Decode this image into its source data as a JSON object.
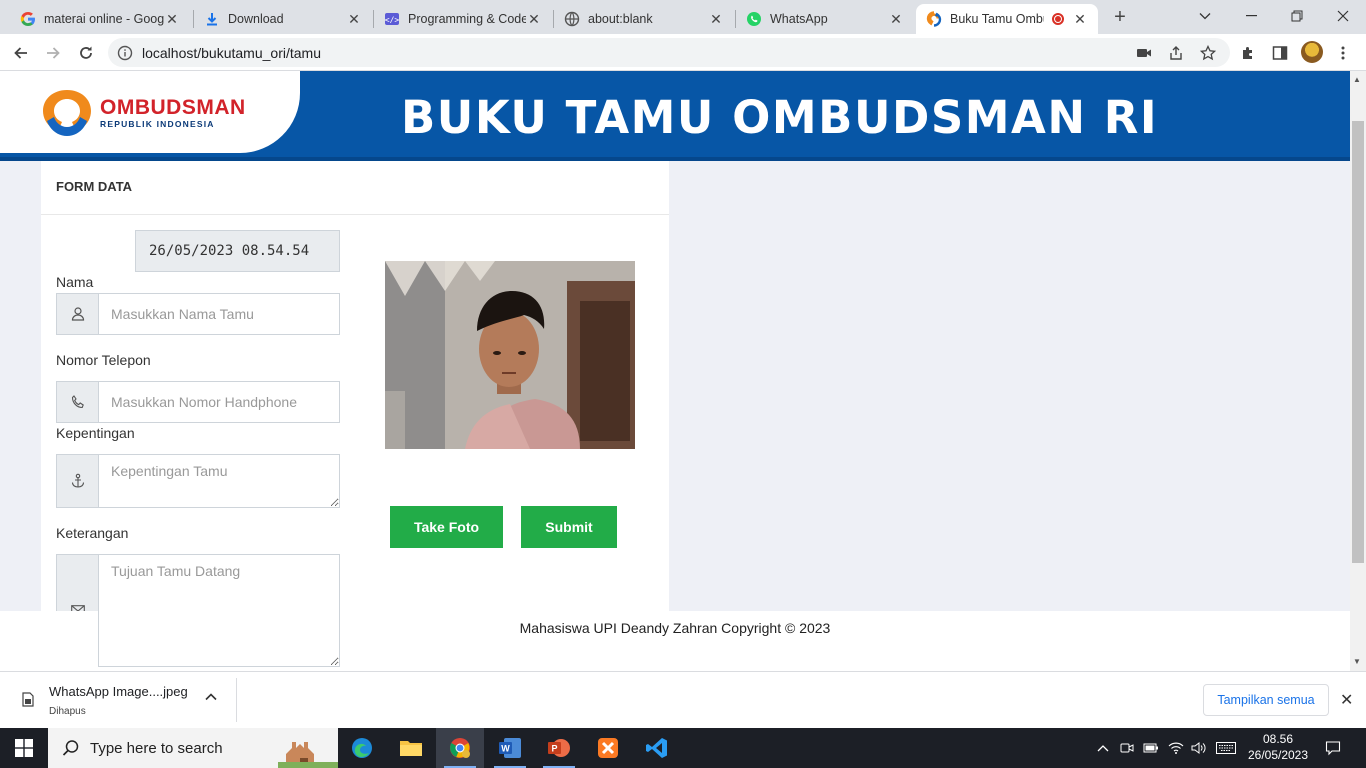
{
  "browser": {
    "tabs": [
      {
        "title": "materai online - Goog",
        "icon": "google-icon"
      },
      {
        "title": "Download",
        "icon": "download-icon"
      },
      {
        "title": "Programming & Code",
        "icon": "code-icon"
      },
      {
        "title": "about:blank",
        "icon": "globe-icon"
      },
      {
        "title": "WhatsApp",
        "icon": "whatsapp-icon"
      },
      {
        "title": "Buku Tamu Ombu",
        "icon": "ombudsman-icon",
        "active": true
      }
    ],
    "url": "localhost/bukutamu_ori/tamu"
  },
  "page": {
    "logo_name": "OMBUDSMAN",
    "logo_sub": "REPUBLIK INDONESIA",
    "banner_title": "BUKU TAMU OMBUDSMAN RI",
    "card_title": "FORM DATA",
    "datetime": "26/05/2023 08.54.54",
    "fields": {
      "nama_label": "Nama",
      "nama_placeholder": "Masukkan Nama Tamu",
      "telepon_label": "Nomor Telepon",
      "telepon_placeholder": "Masukkan Nomor Handphone",
      "kepentingan_label": "Kepentingan",
      "kepentingan_placeholder": "Kepentingan Tamu",
      "keterangan_label": "Keterangan",
      "keterangan_placeholder": "Tujuan Tamu Datang"
    },
    "buttons": {
      "take_photo": "Take Foto",
      "submit": "Submit"
    },
    "footer": "Mahasiswa UPI Deandy Zahran Copyright © 2023"
  },
  "download_bar": {
    "file_name": "WhatsApp Image....jpeg",
    "status": "Dihapus",
    "show_all": "Tampilkan semua"
  },
  "taskbar": {
    "search_placeholder": "Type here to search",
    "time": "08.56",
    "date": "26/05/2023"
  },
  "colors": {
    "banner_blue": "#0756a6",
    "button_green": "#22ac48",
    "logo_red": "#d2232a"
  }
}
